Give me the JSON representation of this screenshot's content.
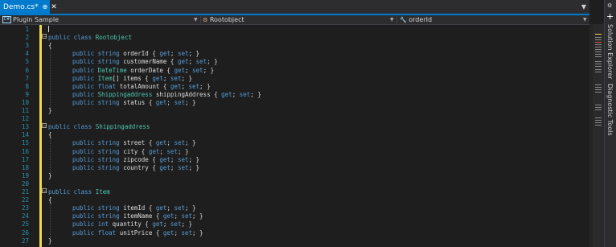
{
  "tab": {
    "title": "Demo.cs*",
    "pin": "⊕",
    "close": "✕"
  },
  "nav": {
    "project": "Plugin Sample",
    "class": "Rootobject",
    "member": "orderId",
    "project_icon": "C#"
  },
  "side_tabs": [
    "Solution Explorer",
    "Diagnostic Tools"
  ],
  "line_numbers": [
    "1",
    "2",
    "3",
    "4",
    "5",
    "6",
    "7",
    "8",
    "9",
    "10",
    "11",
    "12",
    "13",
    "14",
    "15",
    "16",
    "17",
    "18",
    "19",
    "20",
    "21",
    "22",
    "23",
    "24",
    "25",
    "26",
    "27"
  ],
  "code_lines": [
    [],
    [
      [
        "kw",
        "public "
      ],
      [
        "kw",
        "class "
      ],
      [
        "ty",
        "Rootobject"
      ]
    ],
    [
      [
        "id",
        "{"
      ]
    ],
    [
      [
        "kw",
        "public "
      ],
      [
        "kw",
        "string "
      ],
      [
        "id",
        "orderId { "
      ],
      [
        "kw",
        "get"
      ],
      [
        "id",
        "; "
      ],
      [
        "kw",
        "set"
      ],
      [
        "id",
        "; }"
      ]
    ],
    [
      [
        "kw",
        "public "
      ],
      [
        "kw",
        "string "
      ],
      [
        "id",
        "customerName { "
      ],
      [
        "kw",
        "get"
      ],
      [
        "id",
        "; "
      ],
      [
        "kw",
        "set"
      ],
      [
        "id",
        "; }"
      ]
    ],
    [
      [
        "kw",
        "public "
      ],
      [
        "ty",
        "DateTime"
      ],
      [
        "id",
        " orderDate { "
      ],
      [
        "kw",
        "get"
      ],
      [
        "id",
        "; "
      ],
      [
        "kw",
        "set"
      ],
      [
        "id",
        "; }"
      ]
    ],
    [
      [
        "kw",
        "public "
      ],
      [
        "ty",
        "Item"
      ],
      [
        "id",
        "[] items { "
      ],
      [
        "kw",
        "get"
      ],
      [
        "id",
        "; "
      ],
      [
        "kw",
        "set"
      ],
      [
        "id",
        "; }"
      ]
    ],
    [
      [
        "kw",
        "public "
      ],
      [
        "kw",
        "float "
      ],
      [
        "id",
        "totalAmount { "
      ],
      [
        "kw",
        "get"
      ],
      [
        "id",
        "; "
      ],
      [
        "kw",
        "set"
      ],
      [
        "id",
        "; }"
      ]
    ],
    [
      [
        "kw",
        "public "
      ],
      [
        "ty",
        "Shippingaddress"
      ],
      [
        "id",
        " shippingAddress { "
      ],
      [
        "kw",
        "get"
      ],
      [
        "id",
        "; "
      ],
      [
        "kw",
        "set"
      ],
      [
        "id",
        "; }"
      ]
    ],
    [
      [
        "kw",
        "public "
      ],
      [
        "kw",
        "string "
      ],
      [
        "id",
        "status { "
      ],
      [
        "kw",
        "get"
      ],
      [
        "id",
        "; "
      ],
      [
        "kw",
        "set"
      ],
      [
        "id",
        "; }"
      ]
    ],
    [
      [
        "id",
        "}"
      ]
    ],
    [],
    [
      [
        "kw",
        "public "
      ],
      [
        "kw",
        "class "
      ],
      [
        "ty",
        "Shippingaddress"
      ]
    ],
    [
      [
        "id",
        "{"
      ]
    ],
    [
      [
        "kw",
        "public "
      ],
      [
        "kw",
        "string "
      ],
      [
        "id",
        "street { "
      ],
      [
        "kw",
        "get"
      ],
      [
        "id",
        "; "
      ],
      [
        "kw",
        "set"
      ],
      [
        "id",
        "; }"
      ]
    ],
    [
      [
        "kw",
        "public "
      ],
      [
        "kw",
        "string "
      ],
      [
        "id",
        "city { "
      ],
      [
        "kw",
        "get"
      ],
      [
        "id",
        "; "
      ],
      [
        "kw",
        "set"
      ],
      [
        "id",
        "; }"
      ]
    ],
    [
      [
        "kw",
        "public "
      ],
      [
        "kw",
        "string "
      ],
      [
        "id",
        "zipcode { "
      ],
      [
        "kw",
        "get"
      ],
      [
        "id",
        "; "
      ],
      [
        "kw",
        "set"
      ],
      [
        "id",
        "; }"
      ]
    ],
    [
      [
        "kw",
        "public "
      ],
      [
        "kw",
        "string "
      ],
      [
        "id",
        "country { "
      ],
      [
        "kw",
        "get"
      ],
      [
        "id",
        "; "
      ],
      [
        "kw",
        "set"
      ],
      [
        "id",
        "; }"
      ]
    ],
    [
      [
        "id",
        "}"
      ]
    ],
    [],
    [
      [
        "kw",
        "public "
      ],
      [
        "kw",
        "class "
      ],
      [
        "ty",
        "Item"
      ]
    ],
    [
      [
        "id",
        "{"
      ]
    ],
    [
      [
        "kw",
        "public "
      ],
      [
        "kw",
        "string "
      ],
      [
        "id",
        "itemId { "
      ],
      [
        "kw",
        "get"
      ],
      [
        "id",
        "; "
      ],
      [
        "kw",
        "set"
      ],
      [
        "id",
        "; }"
      ]
    ],
    [
      [
        "kw",
        "public "
      ],
      [
        "kw",
        "string "
      ],
      [
        "id",
        "itemName { "
      ],
      [
        "kw",
        "get"
      ],
      [
        "id",
        "; "
      ],
      [
        "kw",
        "set"
      ],
      [
        "id",
        "; }"
      ]
    ],
    [
      [
        "kw",
        "public "
      ],
      [
        "kw",
        "int "
      ],
      [
        "id",
        "quantity { "
      ],
      [
        "kw",
        "get"
      ],
      [
        "id",
        "; "
      ],
      [
        "kw",
        "set"
      ],
      [
        "id",
        "; }"
      ]
    ],
    [
      [
        "kw",
        "public "
      ],
      [
        "kw",
        "float "
      ],
      [
        "id",
        "unitPrice { "
      ],
      [
        "kw",
        "get"
      ],
      [
        "id",
        "; "
      ],
      [
        "kw",
        "set"
      ],
      [
        "id",
        "; }"
      ]
    ],
    [
      [
        "id",
        "}"
      ]
    ]
  ]
}
